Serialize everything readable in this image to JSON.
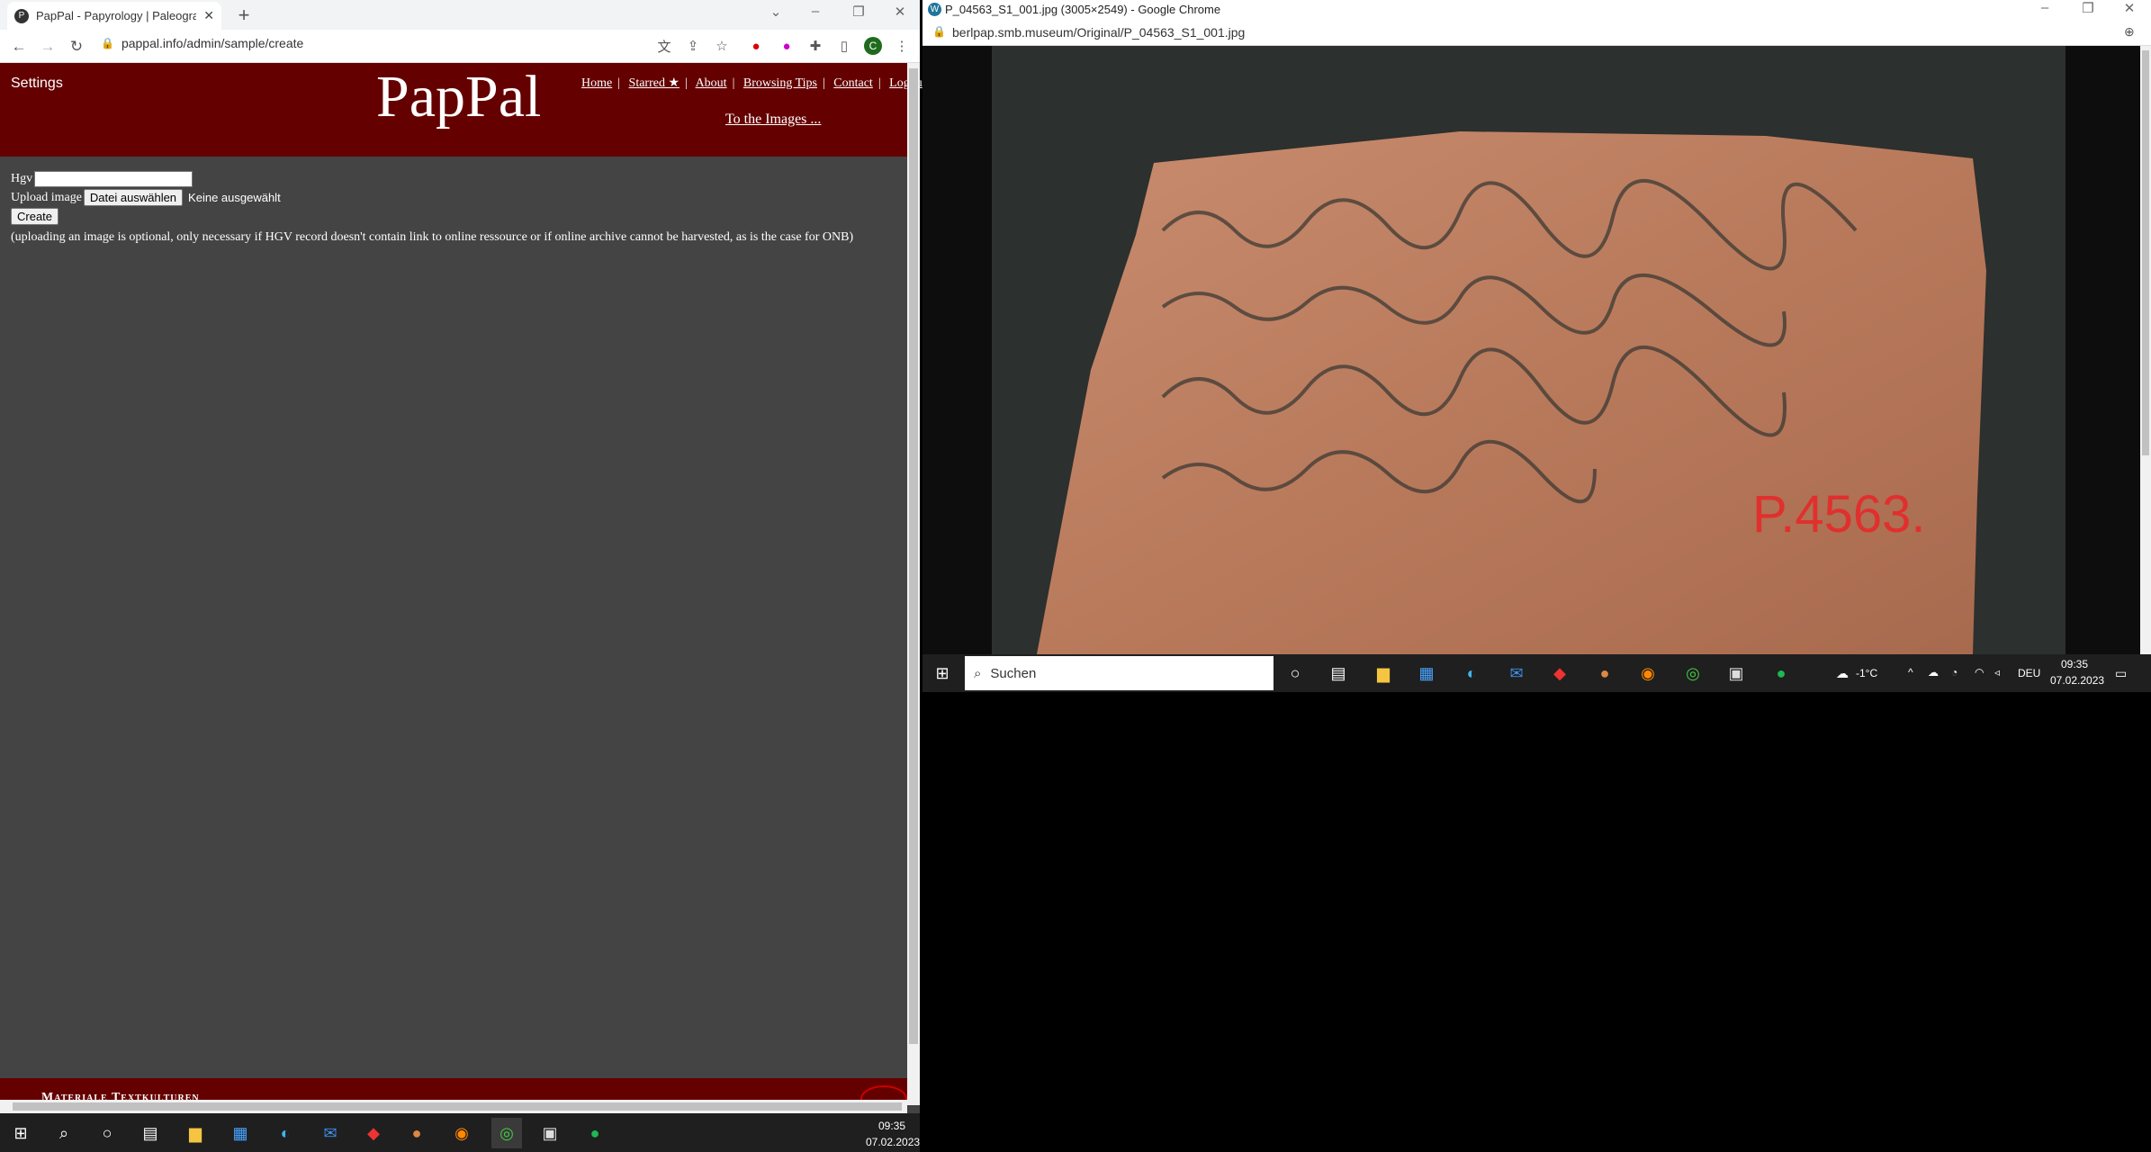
{
  "left_window": {
    "tab_title": "PapPal - Papyrology | Paleograph",
    "url": "pappal.info/admin/sample/create",
    "profile_initial": "C"
  },
  "pappal": {
    "settings_label": "Settings",
    "logo": "PapPal",
    "nav": [
      "Home",
      "Starred ★",
      "About",
      "Browsing Tips",
      "Contact",
      "Logou"
    ],
    "to_images": "To the Images ...",
    "form": {
      "hgv_label": "Hgv",
      "hgv_value": "",
      "upload_label": "Upload image",
      "file_button": "Datei auswählen",
      "no_file": "Keine ausgewählt",
      "create_button": "Create",
      "note": "(uploading an image is optional, only necessary if HGV record doesn't contain link to online ressource or if online archive cannot be harvested, as is the case for ONB)"
    },
    "footer": "Materiale Textkulturen"
  },
  "right_window": {
    "title": "P_04563_S1_001.jpg (3005×2549) - Google Chrome",
    "url": "berlpap.smb.museum/Original/P_04563_S1_001.jpg",
    "label_on_sherd": "P.4563."
  },
  "taskbar_right": {
    "search_placeholder": "Suchen",
    "weather": "-1°C",
    "lang": "DEU",
    "time": "09:35",
    "date": "07.02.2023"
  },
  "taskbar_left": {
    "time": "09:35",
    "date": "07.02.2023"
  }
}
